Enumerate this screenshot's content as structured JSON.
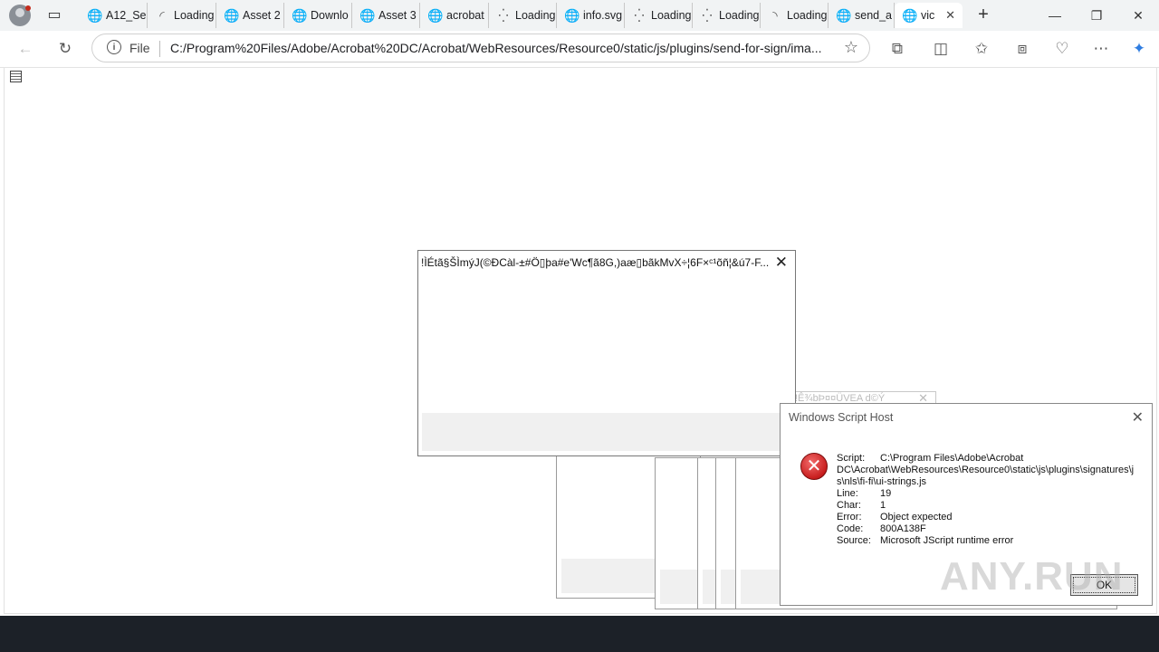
{
  "tabs": [
    {
      "icon": "globe-icon",
      "glyph": "🌐",
      "title": "A12_Sel"
    },
    {
      "icon": "loading-icon",
      "glyph": "◜",
      "title": "Loading"
    },
    {
      "icon": "globe-icon",
      "glyph": "🌐",
      "title": "Asset 2"
    },
    {
      "icon": "globe-icon",
      "glyph": "🌐",
      "title": "Downlo"
    },
    {
      "icon": "globe-icon",
      "glyph": "🌐",
      "title": "Asset 3"
    },
    {
      "icon": "globe-icon",
      "glyph": "🌐",
      "title": "acrobat"
    },
    {
      "icon": "loading-icon",
      "glyph": "⁛",
      "title": "Loading"
    },
    {
      "icon": "globe-icon",
      "glyph": "🌐",
      "title": "info.svg"
    },
    {
      "icon": "loading-icon",
      "glyph": "⁛",
      "title": "Loading"
    },
    {
      "icon": "loading-icon",
      "glyph": "⁛",
      "title": "Loading"
    },
    {
      "icon": "loading-icon",
      "glyph": "◝",
      "title": "Loading"
    },
    {
      "icon": "globe-icon",
      "glyph": "🌐",
      "title": "send_a"
    },
    {
      "icon": "globe-icon",
      "glyph": "🌐",
      "title": "vic"
    }
  ],
  "toolbar": {
    "scheme": "File",
    "url": "C:/Program%20Files/Adobe/Acrobat%20DC/Acrobat/WebResources/Resource0/static/js/plugins/send-for-sign/ima..."
  },
  "mbox": {
    "title": "!ÌÉtã§ŠÌmýJ(©ÐCàl-±#Ö▯þa#e'Wc¶ã8G,)aæ▯bãkMvX÷¦6F×ᶜ¹õñ¦&ú7-F..."
  },
  "ghost": {
    "title": "!Ê¾bÞ¤¤ÜVEA d©Ý"
  },
  "wsh": {
    "title": "Windows Script Host",
    "script_label": "Script:",
    "script_value_1": "C:\\Program Files\\Adobe\\Acrobat",
    "script_value_2": "DC\\Acrobat\\WebResources\\Resource0\\static\\js\\plugins\\signatures\\js\\nls\\fi-fi\\ui-strings.js",
    "line_label": "Line:",
    "line_value": "19",
    "char_label": "Char:",
    "char_value": "1",
    "error_label": "Error:",
    "error_value": "Object expected",
    "code_label": "Code:",
    "code_value": "800A138F",
    "source_label": "Source:",
    "source_value": "Microsoft JScript runtime error",
    "ok_label": "OK"
  },
  "watermark": "ANY.RUN"
}
